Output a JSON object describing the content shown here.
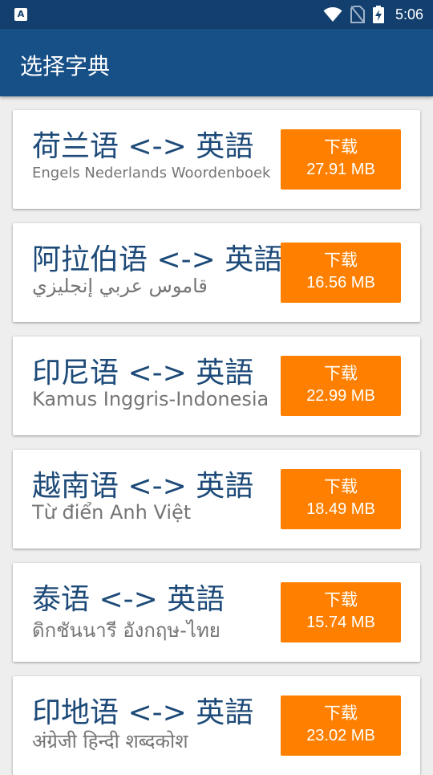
{
  "status_bar": {
    "app_icon_letter": "A",
    "time": "5:06",
    "icons": [
      "wifi-icon",
      "no-sim-icon",
      "battery-charging-icon"
    ]
  },
  "app_bar": {
    "title": "选择字典"
  },
  "colors": {
    "status_bar": "#123f6e",
    "app_bar": "#174f87",
    "title_text": "#1d4a78",
    "subtitle_text": "#757575",
    "download_button": "#ff8000",
    "background": "#eeeeee"
  },
  "dictionaries": [
    {
      "title": "荷兰语 <-> 英語",
      "subtitle": "Engels Nederlands Woordenboek",
      "button_label": "下载",
      "size": "27.91 MB"
    },
    {
      "title": "阿拉伯语 <-> 英語",
      "subtitle": "قاموس عربي إنجليزي",
      "button_label": "下载",
      "size": "16.56 MB"
    },
    {
      "title": "印尼语 <-> 英語",
      "subtitle": "Kamus Inggris-Indonesia",
      "button_label": "下载",
      "size": "22.99 MB"
    },
    {
      "title": "越南语 <-> 英語",
      "subtitle": "Từ điển Anh Việt",
      "button_label": "下载",
      "size": "18.49 MB"
    },
    {
      "title": "泰语 <-> 英語",
      "subtitle": "ดิกชันนารี อังกฤษ-ไทย",
      "button_label": "下载",
      "size": "15.74 MB"
    },
    {
      "title": "印地语 <-> 英語",
      "subtitle": "अंग्रेजी हिन्दी शब्दकोश",
      "button_label": "下载",
      "size": "23.02 MB"
    }
  ]
}
